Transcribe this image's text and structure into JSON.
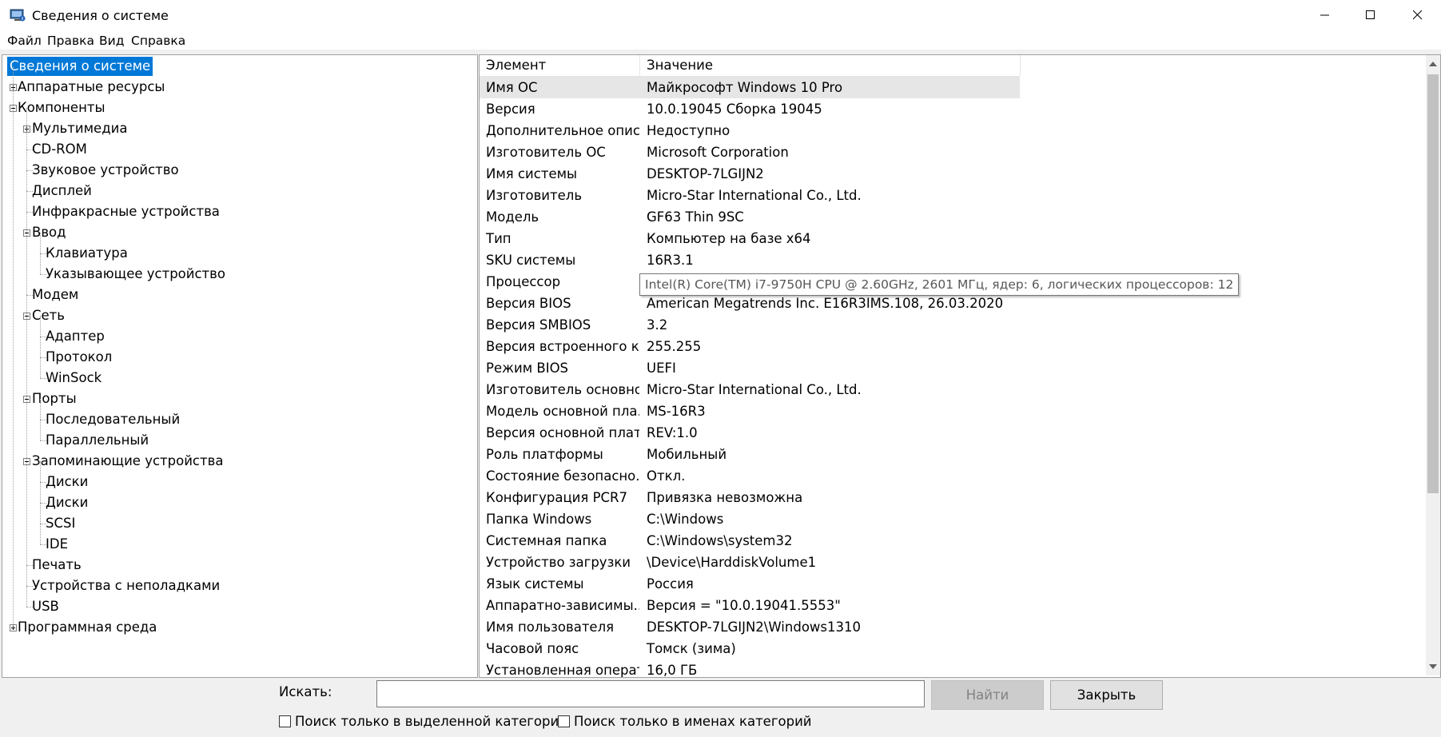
{
  "window": {
    "title": "Сведения о системе",
    "controls": [
      "minimize-icon",
      "maximize-icon",
      "close-icon"
    ]
  },
  "menu": [
    "Файл",
    "Правка",
    "Вид",
    "Справка"
  ],
  "tree": [
    {
      "label": "Сведения о системе",
      "level": 0,
      "selected": true,
      "toggle": "none"
    },
    {
      "label": "Аппаратные ресурсы",
      "level": 0,
      "toggle": "plus"
    },
    {
      "label": "Компоненты",
      "level": 0,
      "toggle": "minus"
    },
    {
      "label": "Мультимедиа",
      "level": 1,
      "toggle": "plus"
    },
    {
      "label": "CD-ROM",
      "level": 1,
      "toggle": "none"
    },
    {
      "label": "Звуковое устройство",
      "level": 1,
      "toggle": "none"
    },
    {
      "label": "Дисплей",
      "level": 1,
      "toggle": "none"
    },
    {
      "label": "Инфракрасные устройства",
      "level": 1,
      "toggle": "none"
    },
    {
      "label": "Ввод",
      "level": 1,
      "toggle": "minus"
    },
    {
      "label": "Клавиатура",
      "level": 2,
      "toggle": "none"
    },
    {
      "label": "Указывающее устройство",
      "level": 2,
      "toggle": "none"
    },
    {
      "label": "Модем",
      "level": 1,
      "toggle": "none"
    },
    {
      "label": "Сеть",
      "level": 1,
      "toggle": "minus"
    },
    {
      "label": "Адаптер",
      "level": 2,
      "toggle": "none"
    },
    {
      "label": "Протокол",
      "level": 2,
      "toggle": "none"
    },
    {
      "label": "WinSock",
      "level": 2,
      "toggle": "none"
    },
    {
      "label": "Порты",
      "level": 1,
      "toggle": "minus"
    },
    {
      "label": "Последовательный",
      "level": 2,
      "toggle": "none"
    },
    {
      "label": "Параллельный",
      "level": 2,
      "toggle": "none"
    },
    {
      "label": "Запоминающие устройства",
      "level": 1,
      "toggle": "minus"
    },
    {
      "label": "Диски",
      "level": 2,
      "toggle": "none"
    },
    {
      "label": "Диски",
      "level": 2,
      "toggle": "none"
    },
    {
      "label": "SCSI",
      "level": 2,
      "toggle": "none"
    },
    {
      "label": "IDE",
      "level": 2,
      "toggle": "none"
    },
    {
      "label": "Печать",
      "level": 1,
      "toggle": "none"
    },
    {
      "label": "Устройства с неполадками",
      "level": 1,
      "toggle": "none"
    },
    {
      "label": "USB",
      "level": 1,
      "toggle": "none"
    },
    {
      "label": "Программная среда",
      "level": 0,
      "toggle": "plus"
    }
  ],
  "list": {
    "headers": [
      "Элемент",
      "Значение"
    ],
    "rows": [
      [
        "Имя ОС",
        "Майкрософт Windows 10 Pro"
      ],
      [
        "Версия",
        "10.0.19045 Сборка 19045"
      ],
      [
        "Дополнительное опис...",
        "Недоступно"
      ],
      [
        "Изготовитель ОС",
        "Microsoft Corporation"
      ],
      [
        "Имя системы",
        "DESKTOP-7LGIJN2"
      ],
      [
        "Изготовитель",
        "Micro-Star International Co., Ltd."
      ],
      [
        "Модель",
        "GF63 Thin 9SC"
      ],
      [
        "Тип",
        "Компьютер на базе x64"
      ],
      [
        "SKU системы",
        "16R3.1"
      ],
      [
        "Процессор",
        ""
      ],
      [
        "Версия BIOS",
        "American Megatrends Inc. E16R3IMS.108, 26.03.2020"
      ],
      [
        "Версия SMBIOS",
        "3.2"
      ],
      [
        "Версия встроенного к...",
        "255.255"
      ],
      [
        "Режим BIOS",
        "UEFI"
      ],
      [
        "Изготовитель основно...",
        "Micro-Star International Co., Ltd."
      ],
      [
        "Модель основной пла...",
        "MS-16R3"
      ],
      [
        "Версия основной платы",
        "REV:1.0"
      ],
      [
        "Роль платформы",
        "Мобильный"
      ],
      [
        "Состояние безопасно...",
        "Откл."
      ],
      [
        "Конфигурация PCR7",
        "Привязка невозможна"
      ],
      [
        "Папка Windows",
        "C:\\Windows"
      ],
      [
        "Системная папка",
        "C:\\Windows\\system32"
      ],
      [
        "Устройство загрузки",
        "\\Device\\HarddiskVolume1"
      ],
      [
        "Язык системы",
        "Россия"
      ],
      [
        "Аппаратно-зависимы...",
        "Версия = \"10.0.19041.5553\""
      ],
      [
        "Имя пользователя",
        "DESKTOP-7LGIJN2\\Windows1310"
      ],
      [
        "Часовой пояс",
        "Томск (зима)"
      ],
      [
        "Установленная операт...",
        "16,0 ГБ"
      ]
    ],
    "selected_row": 0
  },
  "tooltip": "Intel(R) Core(TM) i7-9750H CPU @ 2.60GHz, 2601 МГц, ядер: 6, логических процессоров: 12",
  "search": {
    "label": "Искать:",
    "value": "",
    "find_button": "Найти",
    "close_button": "Закрыть",
    "checkbox_selected_category": "Поиск только в выделенной категории",
    "checkbox_category_names": "Поиск только в именах категорий"
  },
  "colors": {
    "selection": "#0078d7",
    "row_highlight": "#e6e6e6",
    "tree_lines": "#a0a0a0"
  }
}
